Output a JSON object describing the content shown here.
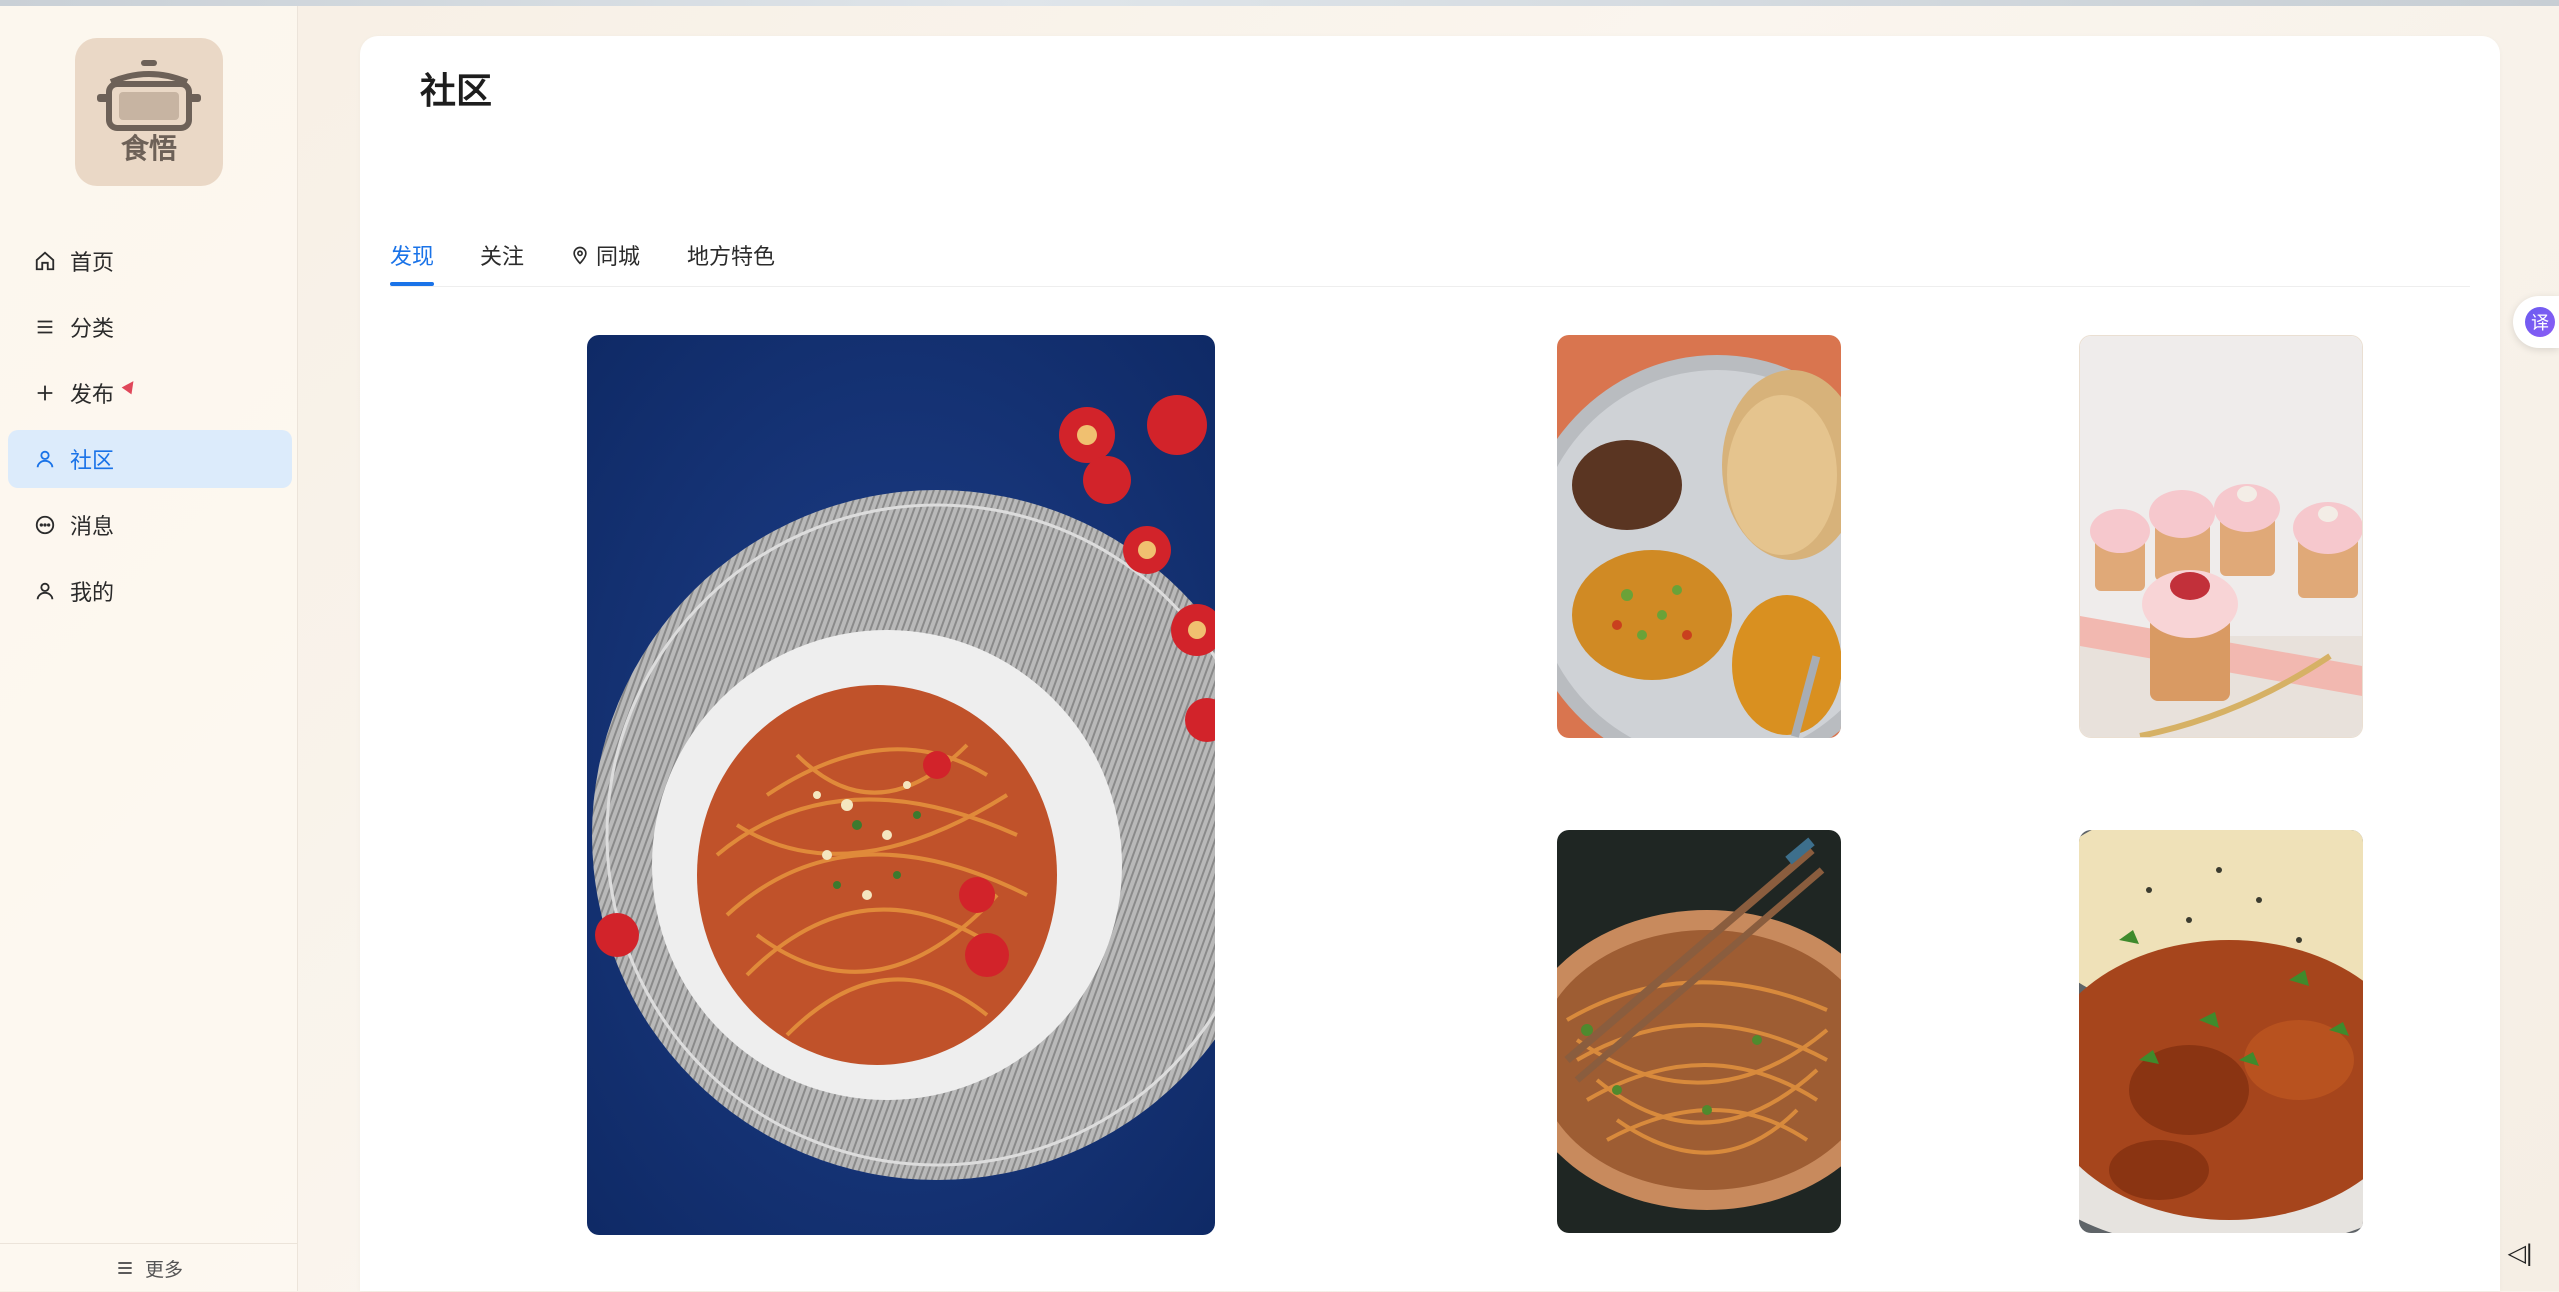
{
  "app": {
    "logo_text": "食悟"
  },
  "sidebar": {
    "items": [
      {
        "label": "首页",
        "icon": "home-icon",
        "active": false
      },
      {
        "label": "分类",
        "icon": "menu-icon",
        "active": false
      },
      {
        "label": "发布",
        "icon": "plus-icon",
        "active": false
      },
      {
        "label": "社区",
        "icon": "user-icon",
        "active": true
      },
      {
        "label": "消息",
        "icon": "chat-icon",
        "active": false
      },
      {
        "label": "我的",
        "icon": "user-icon",
        "active": false
      }
    ],
    "more_label": "更多"
  },
  "main": {
    "title": "社区",
    "tabs": [
      {
        "label": "发现",
        "active": true
      },
      {
        "label": "关注",
        "active": false
      },
      {
        "label": "同城",
        "active": false,
        "icon": "location-pin-icon"
      },
      {
        "label": "地方特色",
        "active": false
      }
    ],
    "cards": [
      {
        "name": "spaghetti",
        "alt": "spaghetti"
      },
      {
        "name": "thali-platter",
        "alt": "thali"
      },
      {
        "name": "cupcakes",
        "alt": "cupcakes"
      },
      {
        "name": "noodles-chopsticks",
        "alt": "noodles"
      },
      {
        "name": "curry-naan",
        "alt": "curry"
      }
    ]
  },
  "overlay": {
    "translate_label": "译",
    "collapse_label": "◁|"
  },
  "colors": {
    "accent": "#1a73e8",
    "active_bg": "#dcebfb",
    "logo_bg": "#ead8c6"
  }
}
